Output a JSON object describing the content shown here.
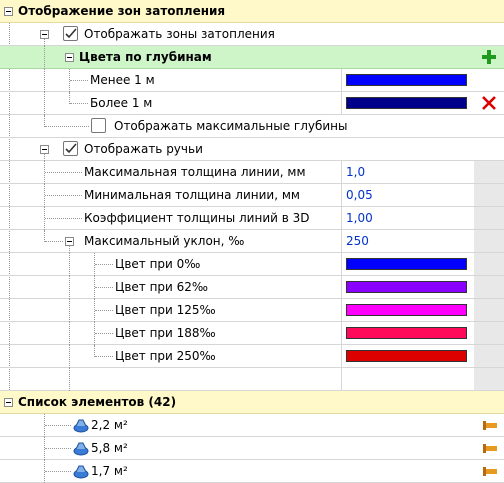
{
  "rows": {
    "flood_zones": "Отображение зон затопления",
    "show_flood_zones": "Отображать зоны затопления",
    "depth_colors": "Цвета по глубинам",
    "less_1m": "Менее 1 м",
    "more_1m": "Более 1 м",
    "show_max_depths": "Отображать максимальные глубины",
    "show_streams": "Отображать ручьи",
    "max_line_width": "Максимальная толщина линии, мм",
    "min_line_width": "Минимальная толщина линии, мм",
    "line_width_coef_3d": "Коэффициент толщины линий в 3D",
    "max_slope": "Максимальный уклон, ‰",
    "color_0": "Цвет при 0‰",
    "color_62": "Цвет при 62‰",
    "color_125": "Цвет при 125‰",
    "color_188": "Цвет при 188‰",
    "color_250": "Цвет при 250‰",
    "element_list": "Список элементов (42)",
    "el1": "2,2 м²",
    "el2": "5,8 м²",
    "el3": "1,7 м²"
  },
  "values": {
    "max_line_width": "1,0",
    "min_line_width": "0,05",
    "line_width_coef_3d": "1,00",
    "max_slope": "250"
  },
  "checkboxes": {
    "show_flood_zones": true,
    "show_max_depths": false,
    "show_streams": true
  },
  "colors": {
    "less_1m": "#0000ff",
    "more_1m": "#00008b",
    "color_0": "#0000ff",
    "color_62": "#8a00ff",
    "color_125": "#ff00ff",
    "color_188": "#ff0a5a",
    "color_250": "#dd0000",
    "category_bg": "#fff9c9",
    "subcategory_bg": "#cdf5c8",
    "value_text": "#0033cc"
  },
  "icons": {
    "add": "plus-icon",
    "remove": "x-icon",
    "element": "water-element-icon",
    "drag": "ruler-icon"
  }
}
